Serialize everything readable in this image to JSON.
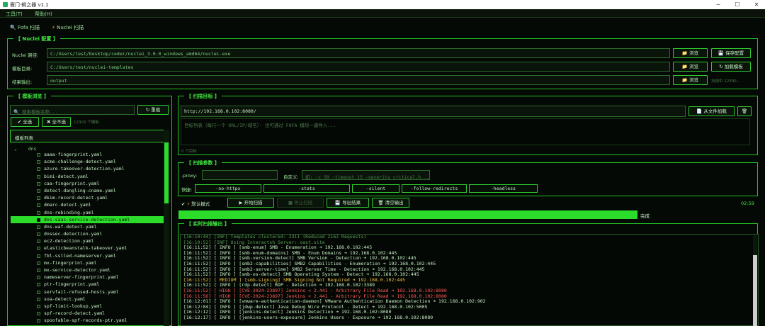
{
  "window": {
    "title": "寰门·蝎之器 v1.1",
    "minimize": "─",
    "maximize": "☐",
    "close": "✕"
  },
  "menu": [
    "工具(T)",
    "帮助(H)"
  ],
  "tabs": [
    {
      "icon": "search-icon",
      "label": "Fofa 扫描"
    },
    {
      "icon": "bolt-icon",
      "label": "Nuclei 扫描"
    }
  ],
  "config": {
    "title": "【 Nuclei 配置 】",
    "rows": [
      {
        "label": "Nuclei 路径:",
        "value": "C:/Users/test/Desktop/ceder/nuclei_3.0.0_windows_amd64/nuclei.exe",
        "browse": "浏览",
        "extra": "保存配置"
      },
      {
        "label": "模板目录:",
        "value": "C:/Users/test/nuclei-templates",
        "browse": "浏览",
        "extra": "加载模板"
      },
      {
        "label": "结果输出:",
        "value": "output",
        "browse": "浏览",
        "extra": "扫描中 12300..."
      }
    ]
  },
  "template_browser": {
    "title": "【 模板浏览 】",
    "search_placeholder": "搜索模板名称...",
    "reload": "重载",
    "select_all": "全选",
    "select_none": "全不选",
    "count": "12302 个模板",
    "list_header": "模板列表",
    "folder": "dns",
    "selected_index": 19,
    "items": [
      "aaaa-fingerprint.yaml",
      "acme-challenge-detect.yaml",
      "azure-takeover-detection.yaml",
      "bimi-detect.yaml",
      "caa-fingerprint.yaml",
      "detect-dangling-cname.yaml",
      "dkim-record-detect.yaml",
      "dmarc-detect.yaml",
      "dns-rebinding.yaml",
      "dns-saas-service-detection.yaml",
      "dns-waf-detect.yaml",
      "dnssec-detection.yaml",
      "ec2-detection.yaml",
      "elasticbeanstalk-takeover.yaml",
      "fbl-sslled-nameserver.yaml",
      "mx-fingerprint.yaml",
      "mx-service-detector.yaml",
      "nameserver-fingerprint.yaml",
      "ptr-fingerprint.yaml",
      "servfail-refused-hosts.yaml",
      "soa-detect.yaml",
      "spf-limit-lookup.yaml",
      "spf-record-detect.yaml",
      "spoofable-spf-records-ptr.yaml"
    ]
  },
  "target": {
    "title": "【 扫描目标 】",
    "value": "http://192.168.0.102:8080/",
    "load_file": "从文件加载",
    "hint": "目标列表（每行一个 URL/IP/域名）· 也可通过 FOFA 模块一键导入...",
    "count": "0 个目标"
  },
  "params": {
    "title": "【 扫描参数 】",
    "proxy_label": "-proxy:",
    "custom_label": "自定义:",
    "custom_placeholder": "如: -c 50 -timeout 15 -severity critical,h...",
    "quick_label": "快捷:",
    "quick": [
      "-no-httpx",
      "-stats",
      "-silent",
      "-follow-redirects",
      "-headless"
    ]
  },
  "actions": {
    "mode": "默认模式",
    "start": "开始扫描",
    "stop": "停止扫描",
    "export": "导出结果",
    "clear": "清空输出",
    "elapsed": "02:59"
  },
  "progress": {
    "value": 1.0,
    "label": "完成"
  },
  "output": {
    "title": "【 实时扫描输出 】",
    "lines": [
      {
        "lvl": "meta",
        "t": "[16:10:44] [INF] Templates clustered: 2311 (Reduced 2162 Requests)"
      },
      {
        "lvl": "meta",
        "t": "[16:10:52] [INF] Using Interactsh Server: oast.site"
      },
      {
        "lvl": "info",
        "t": "[16:11:52] [  INFO  ] [smb-enum] SMB - Enumeration  ➜  192.168.0.102:445"
      },
      {
        "lvl": "info",
        "t": "[16:11:52] [  INFO  ] [smb-enum-domains] SMB - Enum Domains  ➜  192.168.0.102:445"
      },
      {
        "lvl": "info",
        "t": "[16:11:52] [  INFO  ] [smb-version-detect] SMB Version - Detection  ➜  192.168.0.102:445"
      },
      {
        "lvl": "info",
        "t": "[16:11:52] [  INFO  ] [smb2-capabilities] SMB2 Capabilities - Enumeration  ➜  192.168.0.102:445"
      },
      {
        "lvl": "info",
        "t": "[16:11:52] [  INFO  ] [smb2-server-time] SMB2 Server Time - Detection  ➜  192.168.0.102:445"
      },
      {
        "lvl": "info",
        "t": "[16:11:52] [  INFO  ] [smb-os-detect] SMB Operating System - Detect  ➜  192.168.0.102:445"
      },
      {
        "lvl": "medium",
        "t": "[16:11:52] [ MEDIUM ] [smb-signing] SMB Signing Not Required  ➜  192.168.0.102:445"
      },
      {
        "lvl": "info",
        "t": "[16:11:52] [  INFO  ] [rdp-detect] RDP - Detection  ➜  192.168.0.102:3389"
      },
      {
        "lvl": "high",
        "t": "[16:11:52] [  HIGH  ] [CVE-2024-23897] Jenkins < 2.441 - Arbitrary File Read  ➜  192.168.0.102:8080"
      },
      {
        "lvl": "high",
        "t": "[16:11:56] [  HIGH  ] [CVE-2024-23897] Jenkins < 2.441 - Arbitrary File Read  ➜  192.168.0.102:8080"
      },
      {
        "lvl": "info",
        "t": "[16:12:01] [  INFO  ] [vmware-authentication-daemon] VMware Authentication Daemon Detection  ➜  192.168.0.102:902"
      },
      {
        "lvl": "info",
        "t": "[16:12:04] [  INFO  ] [jdwp-detect] Java Debug Wire Protocol - Detect  ➜  192.168.0.102:5005"
      },
      {
        "lvl": "info",
        "t": "[16:12:12] [  INFO  ] [jenkins-detect] Jenkins Detection  ➜  192.168.0.102:8080"
      },
      {
        "lvl": "info",
        "t": "[16:12:17] [  INFO  ] [jenkins-users-exposure] Jenkins Users - Exposure  ➜  192.168.0.102:8080"
      }
    ]
  },
  "colors": {
    "accent": "#2bdc2b",
    "bg": "#050905",
    "high": "#ff5a5a",
    "medium": "#f0c040"
  }
}
